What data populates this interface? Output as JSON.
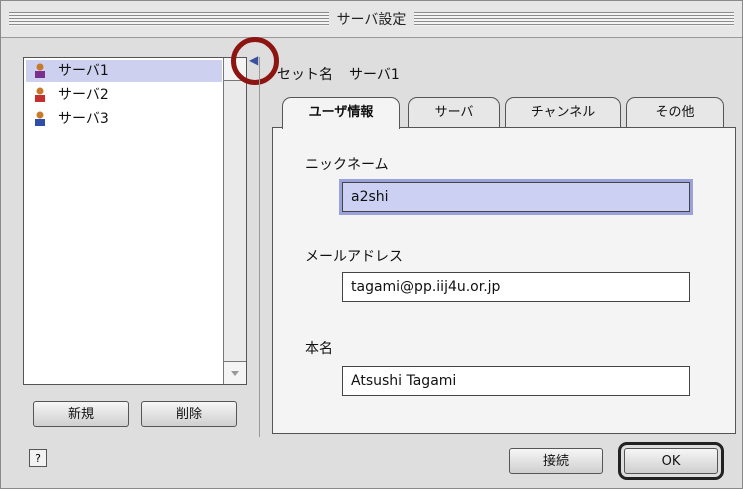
{
  "window": {
    "title": "サーバ設定"
  },
  "server_list": {
    "items": [
      {
        "label": "サーバ1",
        "selected": true
      },
      {
        "label": "サーバ2",
        "selected": false
      },
      {
        "label": "サーバ3",
        "selected": false
      }
    ]
  },
  "buttons": {
    "new": "新規",
    "delete": "削除",
    "connect": "接続",
    "ok": "OK"
  },
  "set_name": {
    "label": "セット名",
    "value": "サーバ1"
  },
  "tabs": [
    {
      "label": "ユーザ情報",
      "active": true
    },
    {
      "label": "サーバ",
      "active": false
    },
    {
      "label": "チャンネル",
      "active": false
    },
    {
      "label": "その他",
      "active": false
    }
  ],
  "form": {
    "nickname_label": "ニックネーム",
    "nickname_value": "a2shi",
    "email_label": "メールアドレス",
    "email_value": "tagami@pp.iij4u.or.jp",
    "realname_label": "本名",
    "realname_value": "Atsushi Tagami"
  },
  "icons": {
    "help": "?",
    "collapse": "◀"
  },
  "colors": {
    "selection": "#cdd0ee",
    "highlight_circle": "#8c1512"
  }
}
